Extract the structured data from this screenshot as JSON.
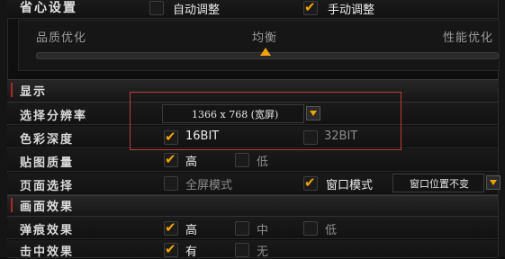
{
  "settings": {
    "title": "省心设置",
    "auto_label": "自动调整",
    "manual_label": "手动调整",
    "auto_checked": false,
    "manual_checked": true
  },
  "quality": {
    "left": "品质优化",
    "mid": "均衡",
    "right": "性能优化",
    "level": 0.5
  },
  "display": {
    "title": "显示",
    "resolution_label": "选择分辨率",
    "resolution_value": "1366 x 768 (宽屏)",
    "color_label": "色彩深度",
    "color_opt1": "16BIT",
    "color_opt2": "32BIT",
    "texture_label": "贴图质量",
    "texture_high": "高",
    "texture_low": "低",
    "page_label": "页面选择",
    "fullscreen": "全屏模式",
    "windowed": "窗口模式",
    "window_pos": "窗口位置不变"
  },
  "effects": {
    "title": "画面效果",
    "bullet_label": "弹痕效果",
    "bullet_high": "高",
    "bullet_mid": "中",
    "bullet_low": "低",
    "hit_label": "击中效果",
    "hit_yes": "有",
    "hit_no": "无"
  },
  "colors": {
    "accent": "#f0a400",
    "highlight": "#c23a3a"
  }
}
